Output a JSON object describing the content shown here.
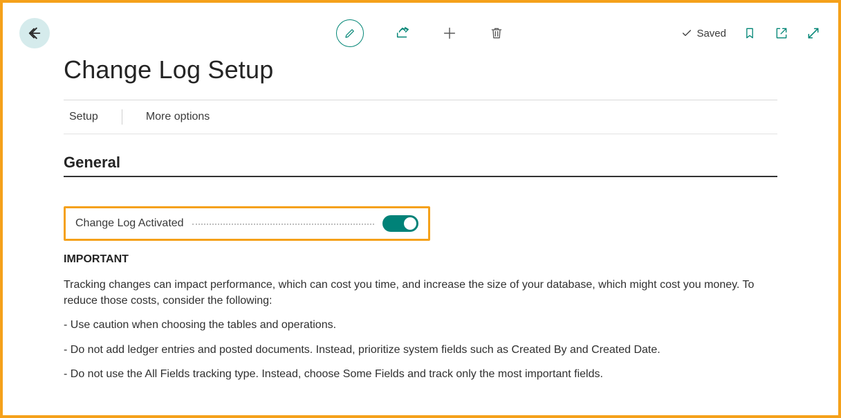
{
  "header": {
    "status_label": "Saved"
  },
  "page": {
    "title": "Change Log Setup"
  },
  "tabs": {
    "setup": "Setup",
    "more_options": "More options"
  },
  "section": {
    "general": "General"
  },
  "field": {
    "change_log_activated_label": "Change Log Activated",
    "change_log_activated_value": true
  },
  "notice": {
    "heading": "IMPORTANT",
    "intro": "Tracking changes can impact performance, which can cost you time, and increase the size of your database, which might cost you money. To reduce those costs, consider the following:",
    "items": [
      "- Use caution when choosing the tables and operations.",
      "- Do not add ledger entries and posted documents. Instead, prioritize system fields such as Created By and Created Date.",
      "- Do not use the All Fields tracking type. Instead, choose Some Fields and track only the most important fields."
    ]
  },
  "colors": {
    "accent": "#008575",
    "frame_highlight": "#f5a11a"
  }
}
